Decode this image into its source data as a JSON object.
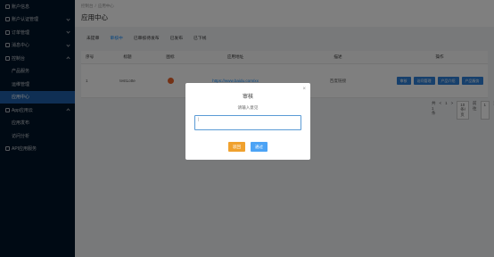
{
  "sidebar": {
    "items": [
      {
        "label": "账户信息",
        "sub": false,
        "chev": false
      },
      {
        "label": "账户认证管理",
        "sub": false,
        "chev": true
      },
      {
        "label": "订单管理",
        "sub": false,
        "chev": true
      },
      {
        "label": "消息中心",
        "sub": false,
        "chev": true
      },
      {
        "label": "控制台",
        "sub": false,
        "chev": true
      },
      {
        "label": "产品服务",
        "sub": true,
        "chev": false
      },
      {
        "label": "运维管理",
        "sub": true,
        "chev": false
      },
      {
        "label": "应用中心",
        "sub": true,
        "chev": false,
        "active": true
      },
      {
        "label": "App应用云",
        "sub": false,
        "chev": true
      },
      {
        "label": "应用发布",
        "sub": true,
        "chev": false
      },
      {
        "label": "访问分析",
        "sub": true,
        "chev": false
      },
      {
        "label": "API应用服务",
        "sub": false,
        "chev": false
      }
    ]
  },
  "header": {
    "crumb_1": "控制台",
    "crumb_sep": "/",
    "crumb_2": "应用中心",
    "title": "应用中心"
  },
  "tabs": [
    "未提审",
    "审核中",
    "已审核待发布",
    "已发布",
    "已下线"
  ],
  "table": {
    "headers": [
      "序号",
      "标题",
      "图标",
      "应用地址",
      "描述",
      "操作"
    ],
    "row": {
      "index": "1",
      "title": "testLotte",
      "url": "https://www.baidu.com/xx",
      "desc": "百度链接",
      "ops": [
        "审核",
        "访问管理",
        "产品介绍",
        "产品服务"
      ]
    }
  },
  "pager": {
    "total": "共 1 条",
    "prev": "<",
    "page": "1",
    "next": ">",
    "size": "10条/页",
    "goto": "前往",
    "goto_page": "1",
    "goto_suffix": "页"
  },
  "modal": {
    "title": "审核",
    "subtitle": "请输入意见",
    "close": "×",
    "textarea_value": "|",
    "reject": "驳回",
    "pass": "通过"
  },
  "colors": {
    "sidebar_bg": "#001529",
    "active": "#1f5fa8",
    "primary": "#1890ff",
    "reject": "#f0a12e",
    "pass": "#4ca3f5"
  }
}
